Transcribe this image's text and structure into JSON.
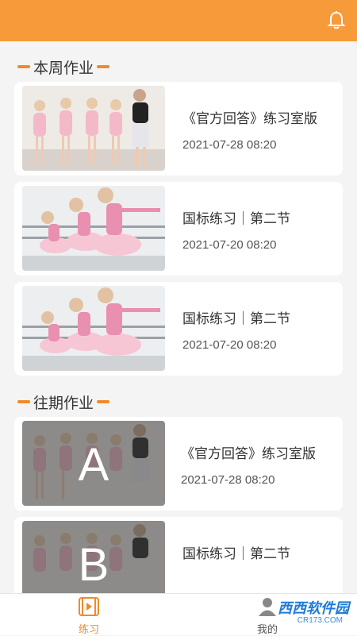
{
  "header": {
    "notification_icon": "bell-icon",
    "accent": "#f79a3a"
  },
  "sections": {
    "this_week": {
      "title": "本周作业"
    },
    "past": {
      "title": "往期作业"
    }
  },
  "this_week_items": [
    {
      "title": "《官方回答》练习室版",
      "date": "2021-07-28 08:20"
    },
    {
      "title": "国标练习｜第二节",
      "date": "2021-07-20 08:20"
    },
    {
      "title": "国标练习｜第二节",
      "date": "2021-07-20 08:20"
    }
  ],
  "past_items": [
    {
      "title": "《官方回答》练习室版",
      "date": "2021-07-28 08:20",
      "grade": "A"
    },
    {
      "title": "国标练习｜第二节",
      "date": "",
      "grade": "B"
    }
  ],
  "tabs": [
    {
      "label": "练习",
      "icon": "video-icon",
      "active": true
    },
    {
      "label": "我的",
      "icon": "user-icon",
      "active": false
    }
  ],
  "watermark": {
    "text": "西西软件园",
    "sub": "CR173.COM"
  }
}
